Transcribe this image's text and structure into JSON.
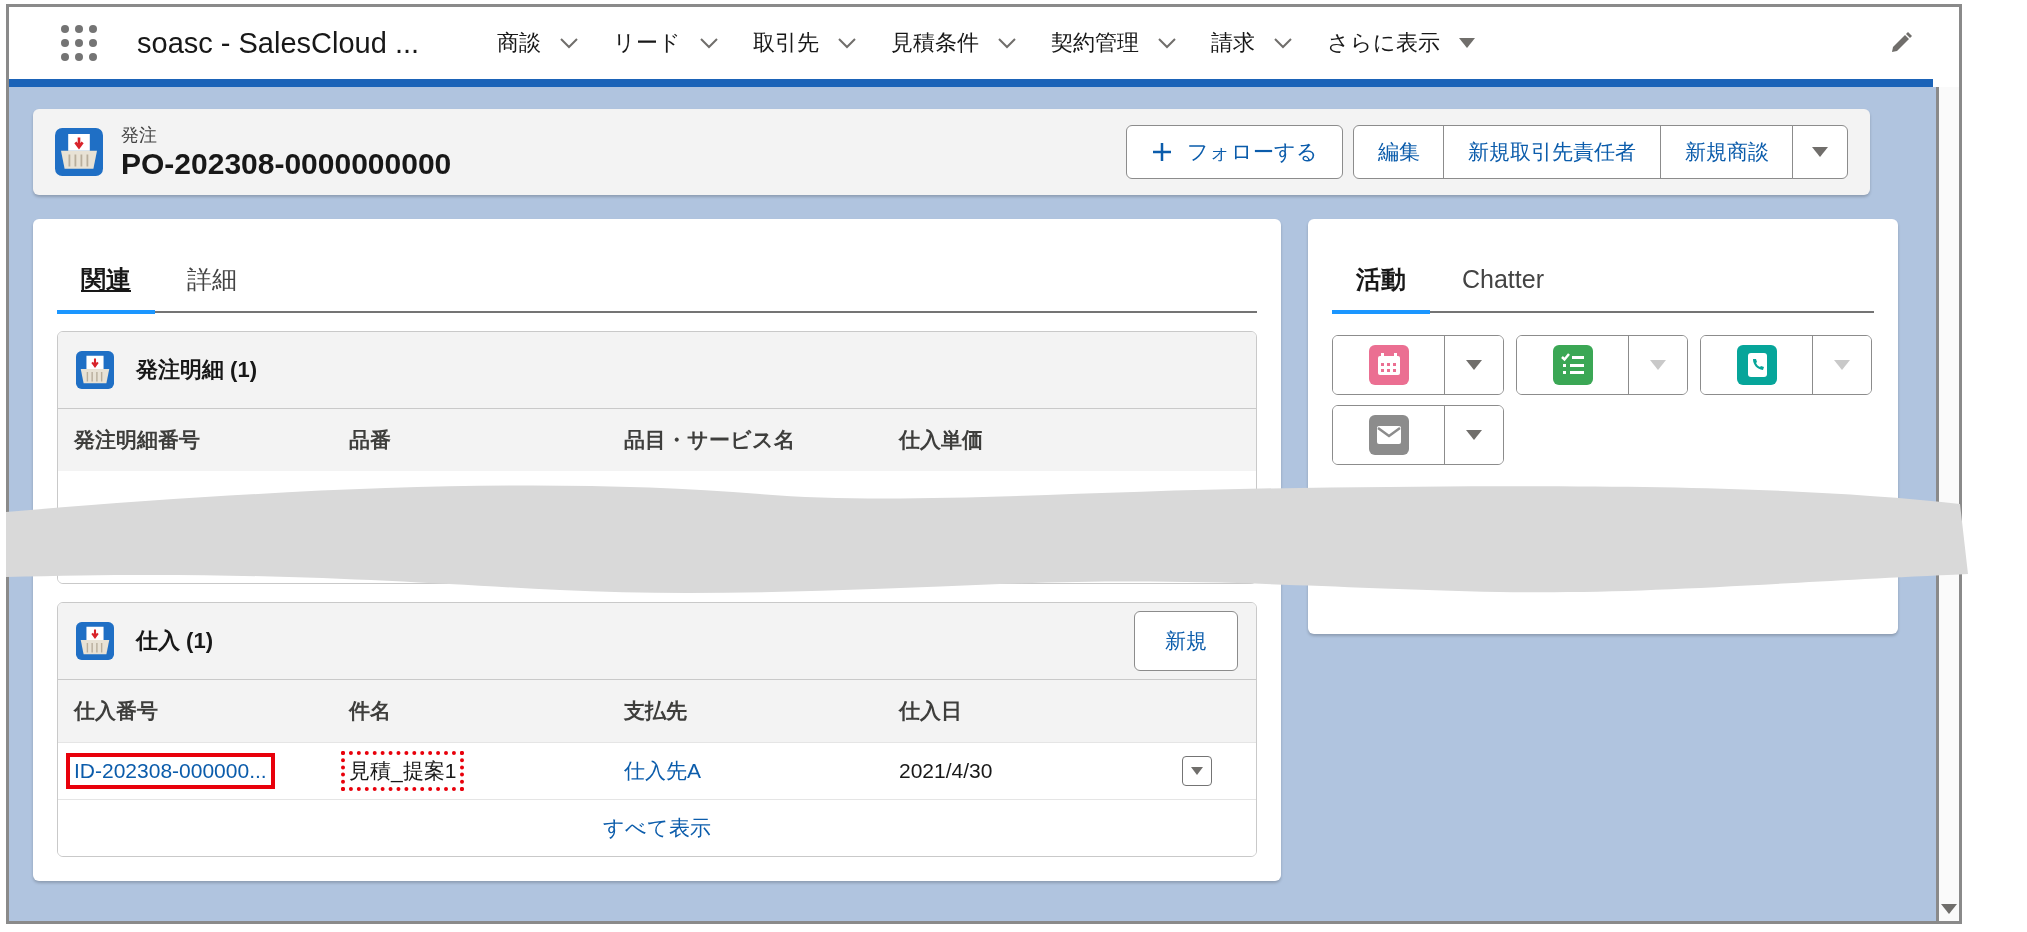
{
  "nav": {
    "app_name": "soasc - SalesCloud ...",
    "items": [
      {
        "label": "商談",
        "kind": "chevron"
      },
      {
        "label": "リード",
        "kind": "chevron"
      },
      {
        "label": "取引先",
        "kind": "chevron"
      },
      {
        "label": "見積条件",
        "kind": "chevron"
      },
      {
        "label": "契約管理",
        "kind": "chevron"
      },
      {
        "label": "請求",
        "kind": "chevron"
      },
      {
        "label": "さらに表示",
        "kind": "caret"
      }
    ]
  },
  "record": {
    "object_label": "発注",
    "title": "PO-202308-0000000000",
    "follow_button": "フォローする",
    "action_buttons": [
      "編集",
      "新規取引先責任者",
      "新規商談"
    ]
  },
  "tabs": [
    {
      "label": "関連",
      "selected": true
    },
    {
      "label": "詳細",
      "selected": false
    }
  ],
  "related_lists": [
    {
      "title": "発注明細 (1)",
      "columns": [
        "発注明細番号",
        "品番",
        "品目・サービス名",
        "仕入単価"
      ]
    },
    {
      "title": "仕入 (1)",
      "new_button": "新規",
      "columns": [
        "仕入番号",
        "件名",
        "支払先",
        "仕入日"
      ],
      "rows": [
        {
          "cells": [
            {
              "text": "ID-202308-000000...",
              "link": true,
              "boxed": true,
              "dotted": false
            },
            {
              "text": "見積_提案1",
              "link": false,
              "boxed": true,
              "dotted": true
            },
            {
              "text": "仕入先A",
              "link": true,
              "boxed": false
            },
            {
              "text": "2021/4/30",
              "link": false,
              "boxed": false
            }
          ]
        }
      ],
      "view_all": "すべて表示"
    }
  ],
  "activity": {
    "tabs": [
      {
        "label": "活動",
        "selected": true
      },
      {
        "label": "Chatter",
        "selected": false
      }
    ],
    "actions": [
      {
        "kind": "event",
        "color": "#eb6f92",
        "menu_disabled": false
      },
      {
        "kind": "task",
        "color": "#3ba755",
        "menu_disabled": true
      },
      {
        "kind": "call",
        "color": "#06a59a",
        "menu_disabled": true
      },
      {
        "kind": "email",
        "color": "#8c8c8c",
        "menu_disabled": false
      }
    ]
  }
}
